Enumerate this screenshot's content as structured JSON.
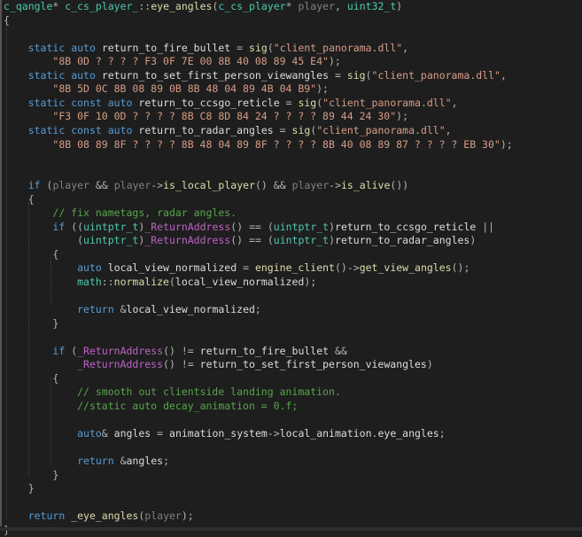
{
  "theme": {
    "background": "#1e1e1e",
    "text": "#dcdcdc",
    "keyword": "#569cd6",
    "type": "#4ec9b0",
    "function": "#dcdcaa",
    "parameter": "#808080",
    "string": "#d69d85",
    "comment": "#57a64a",
    "number": "#b5cea8"
  },
  "code_lines": [
    "c_qangle* c_cs_player_::eye_angles(c_cs_player* player, uint32_t)",
    "{",
    "",
    "    static auto return_to_fire_bullet = sig(\"client_panorama.dll\",",
    "        \"8B 0D ? ? ? ? F3 0F 7E 00 8B 40 08 89 45 E4\");",
    "    static auto return_to_set_first_person_viewangles = sig(\"client_panorama.dll\",",
    "        \"8B 5D 0C 8B 08 89 0B 8B 48 04 89 4B 04 B9\");",
    "    static const auto return_to_ccsgo_reticle = sig(\"client_panorama.dll\",",
    "        \"F3 0F 10 0D ? ? ? ? 8B C8 8D 84 24 ? ? ? ? 89 44 24 30\");",
    "    static const auto return_to_radar_angles = sig(\"client_panorama.dll\",",
    "        \"8B 08 89 8F ? ? ? ? 8B 48 04 89 8F ? ? ? ? 8B 40 08 89 87 ? ? ? ? EB 30\");",
    "",
    "",
    "    if (player && player->is_local_player() && player->is_alive())",
    "    {",
    "        // fix nametags, radar angles.",
    "        if ((uintptr_t)_ReturnAddress() == (uintptr_t)return_to_ccsgo_reticle ||",
    "            (uintptr_t)_ReturnAddress() == (uintptr_t)return_to_radar_angles)",
    "        {",
    "            auto local_view_normalized = engine_client()->get_view_angles();",
    "            math::normalize(local_view_normalized);",
    "",
    "            return &local_view_normalized;",
    "        }",
    "",
    "        if (_ReturnAddress() != return_to_fire_bullet &&",
    "            _ReturnAddress() != return_to_set_first_person_viewangles)",
    "        {",
    "            // smooth out clientside landing animation.",
    "            //static auto decay_animation = 0.f;",
    "",
    "            auto& angles = animation_system->local_animation.eye_angles;",
    "",
    "            return &angles;",
    "        }",
    "    }",
    "",
    "    return _eye_angles(player);",
    "}"
  ]
}
